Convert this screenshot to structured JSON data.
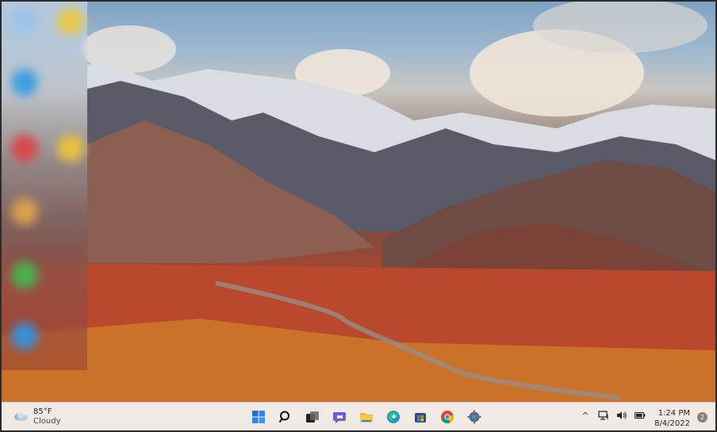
{
  "weather": {
    "temperature": "85°F",
    "condition": "Cloudy",
    "icon": "cloud-icon"
  },
  "taskbar": {
    "apps": [
      {
        "name": "start-button",
        "icon": "windows-logo-icon"
      },
      {
        "name": "search-button",
        "icon": "search-icon"
      },
      {
        "name": "task-view-button",
        "icon": "task-view-icon"
      },
      {
        "name": "chat-button",
        "icon": "teams-chat-icon"
      },
      {
        "name": "file-explorer-button",
        "icon": "folder-icon"
      },
      {
        "name": "edge-button",
        "icon": "edge-icon"
      },
      {
        "name": "store-button",
        "icon": "store-icon"
      },
      {
        "name": "chrome-button",
        "icon": "chrome-icon"
      },
      {
        "name": "settings-button",
        "icon": "gear-icon"
      }
    ]
  },
  "tray": {
    "chevron": "^",
    "icons": [
      "network-icon",
      "volume-icon",
      "battery-icon"
    ]
  },
  "clock": {
    "time": "1:24 PM",
    "date": "8/4/2022"
  },
  "notifications": {
    "count": "2"
  },
  "colors": {
    "taskbar_bg": "#f1e9e4",
    "accent_blue": "#1e73d8"
  }
}
